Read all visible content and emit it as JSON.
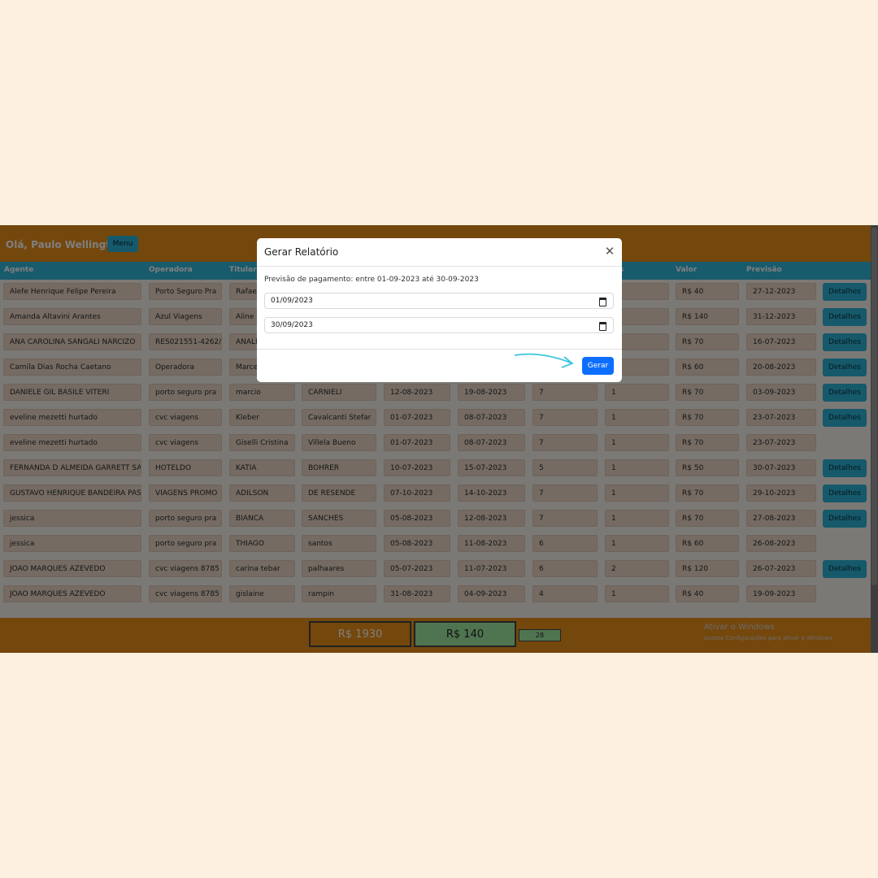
{
  "header": {
    "greeting": "Olá, Paulo Wellington",
    "menu_label": "Menu"
  },
  "table": {
    "columns": [
      "Agente",
      "Operadora",
      "Titular",
      "",
      "",
      "",
      "",
      "s",
      "Valor",
      "Previsão"
    ],
    "rows": [
      {
        "agente": "Alefe Henrique Felipe Pereira",
        "operadora": "Porto Seguro Pra",
        "titular": "Rafae",
        "sobrenome": "",
        "ida": "",
        "volta": "",
        "dias": "",
        "qtd": "",
        "valor": "R$ 40",
        "previsao": "27-12-2023",
        "details": true
      },
      {
        "agente": "Amanda Altavini Arantes",
        "operadora": "Azul Viagens",
        "titular": "Aline",
        "sobrenome": "",
        "ida": "",
        "volta": "",
        "dias": "",
        "qtd": "",
        "valor": "R$ 140",
        "previsao": "31-12-2023",
        "details": true
      },
      {
        "agente": "ANA CAROLINA SANGALI NARCIZO",
        "operadora": "RES021551-4262/",
        "titular": "ANALI",
        "sobrenome": "",
        "ida": "",
        "volta": "",
        "dias": "",
        "qtd": "",
        "valor": "R$ 70",
        "previsao": "16-07-2023",
        "details": true
      },
      {
        "agente": "Camila Dias Rocha Caetano",
        "operadora": "Operadora",
        "titular": "Marce",
        "sobrenome": "",
        "ida": "",
        "volta": "",
        "dias": "",
        "qtd": "",
        "valor": "R$ 60",
        "previsao": "20-08-2023",
        "details": true
      },
      {
        "agente": "DANIELE GIL BASILE VITERI",
        "operadora": "porto seguro pra",
        "titular": "marcio",
        "sobrenome": "CARNIELI",
        "ida": "12-08-2023",
        "volta": "19-08-2023",
        "dias": "7",
        "qtd": "1",
        "valor": "R$ 70",
        "previsao": "03-09-2023",
        "details": true
      },
      {
        "agente": "eveline mezetti hurtado",
        "operadora": "cvc viagens",
        "titular": "Kleber",
        "sobrenome": "Cavalcanti Stefar",
        "ida": "01-07-2023",
        "volta": "08-07-2023",
        "dias": "7",
        "qtd": "1",
        "valor": "R$ 70",
        "previsao": "23-07-2023",
        "details": true
      },
      {
        "agente": "eveline mezetti hurtado",
        "operadora": "cvc viagens",
        "titular": "Giselli Cristina",
        "sobrenome": "Villela Bueno",
        "ida": "01-07-2023",
        "volta": "08-07-2023",
        "dias": "7",
        "qtd": "1",
        "valor": "R$ 70",
        "previsao": "23-07-2023",
        "details": false
      },
      {
        "agente": "FERNANDA D ALMEIDA GARRETT SAN",
        "operadora": "HOTELDO",
        "titular": "KATIA",
        "sobrenome": "BOHRER",
        "ida": "10-07-2023",
        "volta": "15-07-2023",
        "dias": "5",
        "qtd": "1",
        "valor": "R$ 50",
        "previsao": "30-07-2023",
        "details": true
      },
      {
        "agente": "GUSTAVO HENRIQUE BANDEIRA PASS",
        "operadora": "VIAGENS PROMO",
        "titular": "ADILSON",
        "sobrenome": "DE RESENDE",
        "ida": "07-10-2023",
        "volta": "14-10-2023",
        "dias": "7",
        "qtd": "1",
        "valor": "R$ 70",
        "previsao": "29-10-2023",
        "details": true
      },
      {
        "agente": "jessica",
        "operadora": "porto seguro pra",
        "titular": "BIANCA",
        "sobrenome": "SANCHES",
        "ida": "05-08-2023",
        "volta": "12-08-2023",
        "dias": "7",
        "qtd": "1",
        "valor": "R$ 70",
        "previsao": "27-08-2023",
        "details": true
      },
      {
        "agente": "jessica",
        "operadora": "porto seguro pra",
        "titular": "THIAGO",
        "sobrenome": "santos",
        "ida": "05-08-2023",
        "volta": "11-08-2023",
        "dias": "6",
        "qtd": "1",
        "valor": "R$ 60",
        "previsao": "26-08-2023",
        "details": false
      },
      {
        "agente": "JOAO MARQUES AZEVEDO",
        "operadora": "cvc viagens 8785",
        "titular": "carina tebar",
        "sobrenome": "palhaares",
        "ida": "05-07-2023",
        "volta": "11-07-2023",
        "dias": "6",
        "qtd": "2",
        "valor": "R$ 120",
        "previsao": "26-07-2023",
        "details": true
      },
      {
        "agente": "JOAO MARQUES AZEVEDO",
        "operadora": "cvc viagens 8785",
        "titular": "gislaine",
        "sobrenome": "rampin",
        "ida": "31-08-2023",
        "volta": "04-09-2023",
        "dias": "4",
        "qtd": "1",
        "valor": "R$ 40",
        "previsao": "19-09-2023",
        "details": false
      }
    ],
    "details_label": "Detalhes"
  },
  "footer": {
    "total": "R$ 1930",
    "selected": "R$ 140",
    "count": "28",
    "windows_title": "Ativar o Windows",
    "windows_sub": "Acesse Configurações para ativar o Windows."
  },
  "modal": {
    "title": "Gerar Relatório",
    "description": "Previsão de pagamento: entre 01-09-2023 até 30-09-2023",
    "date_start": "01/09/2023",
    "date_end": "30/09/2023",
    "submit_label": "Gerar"
  },
  "colors": {
    "topbar": "#e88e1a",
    "table_header": "#31b6d9",
    "primary": "#0d6efd",
    "arrow": "#3cc6e0"
  }
}
